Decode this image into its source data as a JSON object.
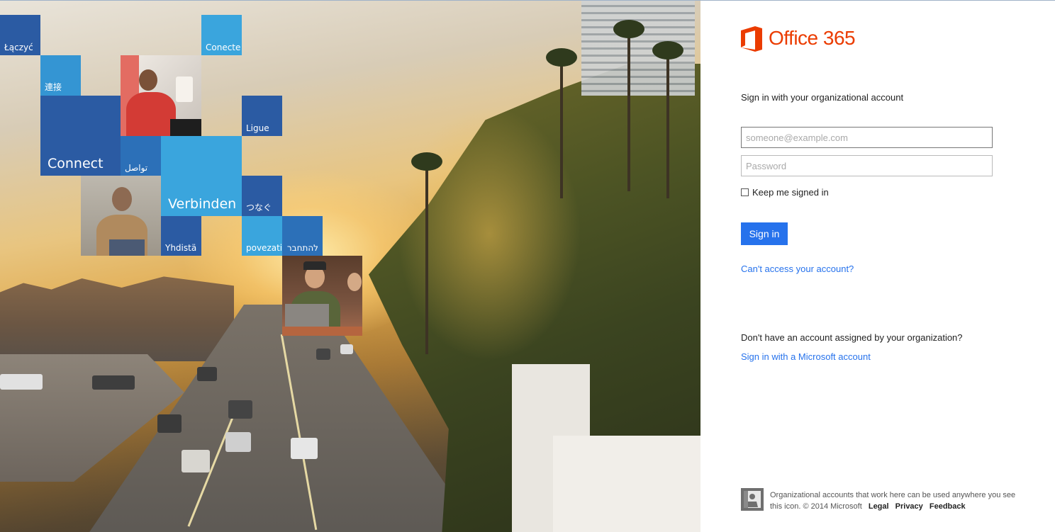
{
  "brand": {
    "name": "Office 365",
    "color": "#eb3c00"
  },
  "signin": {
    "heading": "Sign in with your organizational account",
    "username_placeholder": "someone@example.com",
    "username_value": "",
    "password_placeholder": "Password",
    "keep_signed_in_label": "Keep me signed in",
    "keep_signed_in_checked": false,
    "button_label": "Sign in",
    "button_color": "#2672ec",
    "cant_access_link": "Can't access your account?"
  },
  "alt_account": {
    "question": "Don't have an account assigned by your organization?",
    "link": "Sign in with a Microsoft account"
  },
  "footer": {
    "text": "Organizational accounts that work here can be used anywhere you see this icon. © 2014 Microsoft",
    "links": [
      "Legal",
      "Privacy",
      "Feedback"
    ]
  },
  "tiles": {
    "laczyc": "Łączyć",
    "conecte": "Conecte",
    "lianjie": "連接",
    "ligue": "Ligue",
    "connect": "Connect",
    "tawasal": "تواصل",
    "verbinden": "Verbinden",
    "tsunagu": "つなぐ",
    "yhdista": "Yhdistä",
    "povezati": "povezati",
    "lehitchaber": "להתחבר"
  }
}
